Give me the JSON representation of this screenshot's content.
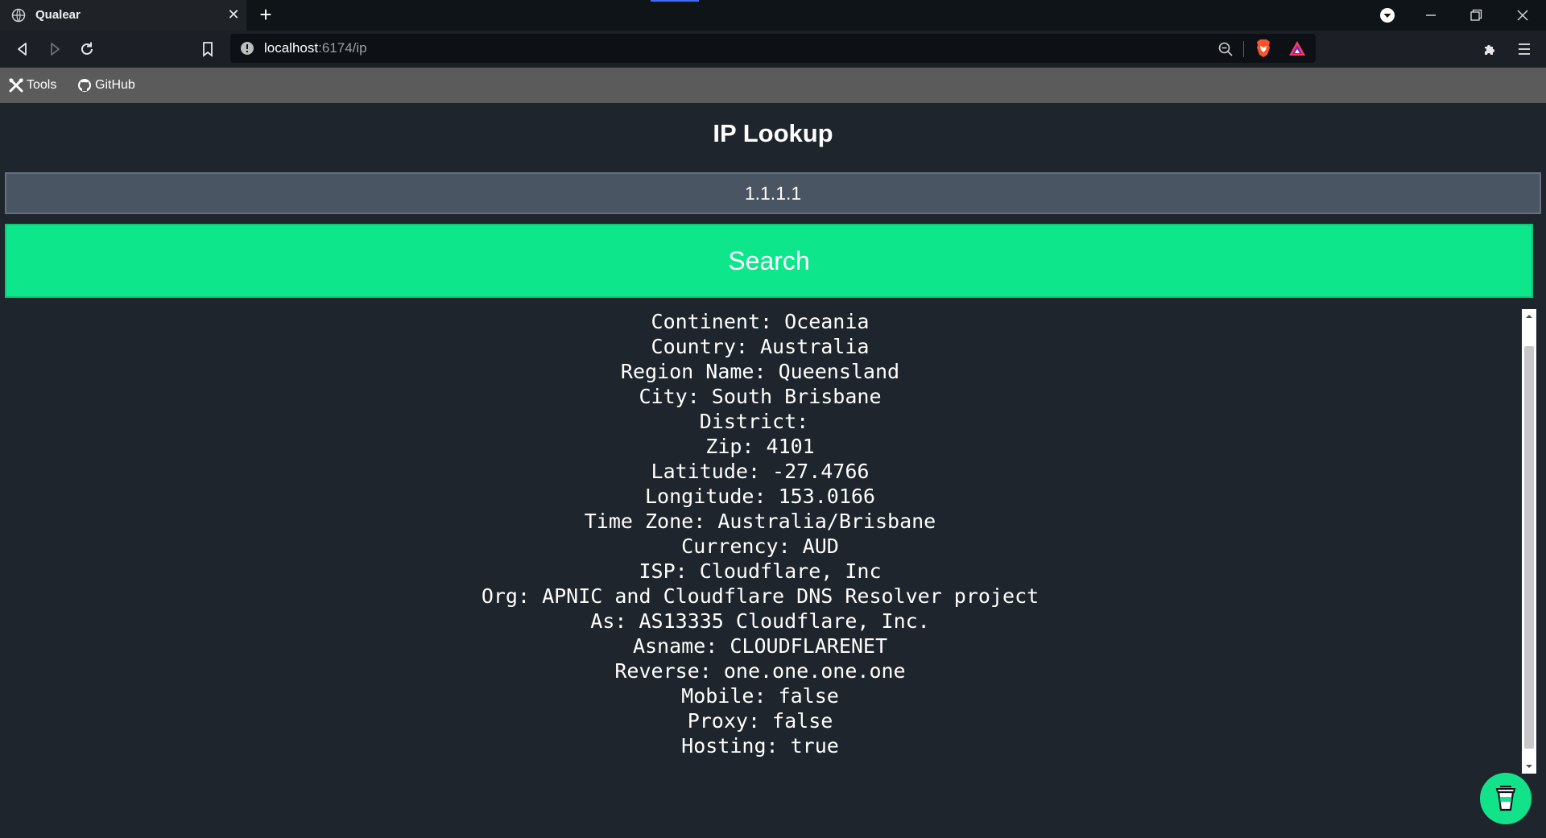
{
  "browser": {
    "tab_title": "Qualear",
    "url_host": "localhost",
    "url_path": ":6174/ip",
    "bookmarks": [
      {
        "label": "Tools",
        "icon": "tools-icon"
      },
      {
        "label": "GitHub",
        "icon": "github-icon"
      }
    ]
  },
  "page": {
    "title": "IP Lookup",
    "ip_input": {
      "value": "1.1.1.1"
    },
    "search_label": "Search",
    "results": [
      "Continent: Oceania",
      "Country: Australia",
      "Region Name: Queensland",
      "City: South Brisbane",
      "District: ",
      "Zip: 4101",
      "Latitude: -27.4766",
      "Longitude: 153.0166",
      "Time Zone: Australia/Brisbane",
      "Currency: AUD",
      "ISP: Cloudflare, Inc",
      "Org: APNIC and Cloudflare DNS Resolver project",
      "As: AS13335 Cloudflare, Inc.",
      "Asname: CLOUDFLARENET",
      "Reverse: one.one.one.one",
      "Mobile: false",
      "Proxy: false",
      "Hosting: true"
    ]
  },
  "colors": {
    "page_bg": "#1f252c",
    "input_bg": "#4a5563",
    "accent_green": "#0de68a"
  }
}
